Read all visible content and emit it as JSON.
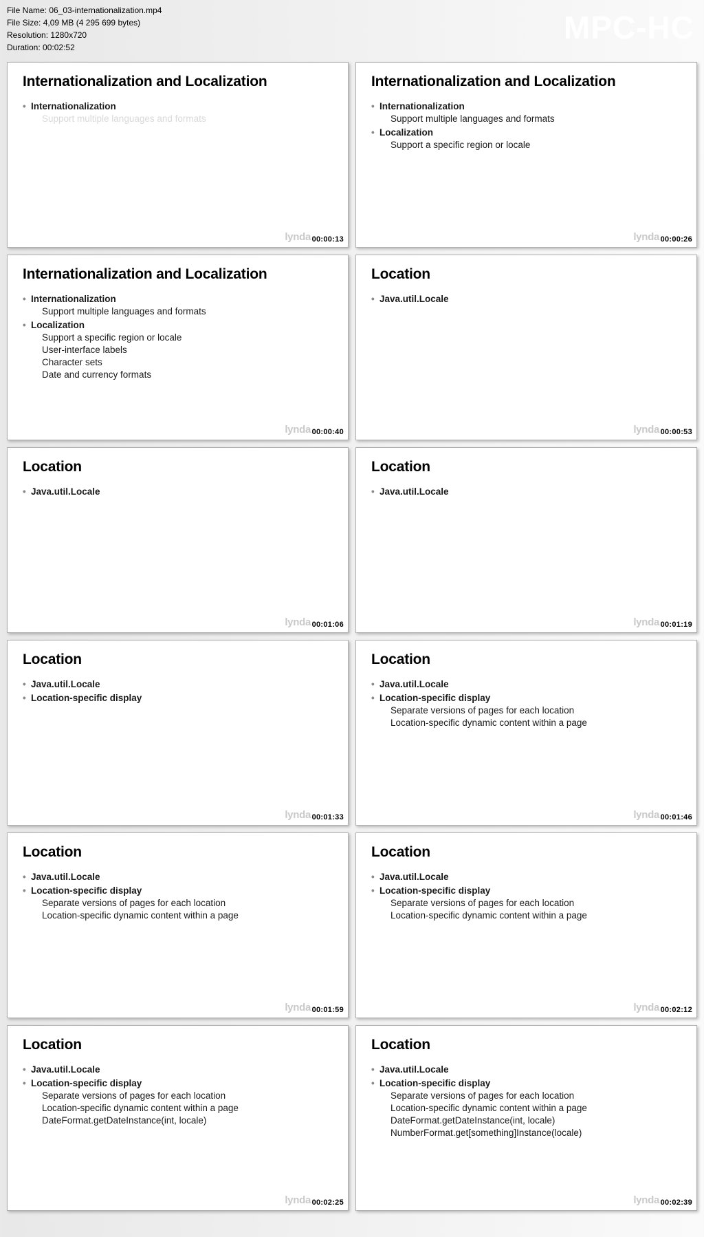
{
  "app_name": "MPC-HC",
  "file_info": {
    "name_label": "File Name:",
    "name_value": "06_03-internationalization.mp4",
    "size_label": "File Size:",
    "size_value": "4,09 MB (4 295 699 bytes)",
    "res_label": "Resolution:",
    "res_value": "1280x720",
    "dur_label": "Duration:",
    "dur_value": "00:02:52"
  },
  "watermark": "lynda",
  "thumbs": [
    {
      "ts": "00:00:13",
      "title": "Internationalization and Localization",
      "items": [
        {
          "text": "Internationalization",
          "bold": true
        },
        {
          "text": "Support multiple languages and formats",
          "sub": true,
          "faded": true
        }
      ]
    },
    {
      "ts": "00:00:26",
      "title": "Internationalization and Localization",
      "items": [
        {
          "text": "Internationalization",
          "bold": true
        },
        {
          "text": "Support multiple languages and formats",
          "sub": true
        },
        {
          "text": "Localization",
          "bold": true
        },
        {
          "text": "Support a specific region or locale",
          "sub": true
        }
      ]
    },
    {
      "ts": "00:00:40",
      "title": "Internationalization and Localization",
      "items": [
        {
          "text": "Internationalization",
          "bold": true
        },
        {
          "text": "Support multiple languages and formats",
          "sub": true
        },
        {
          "text": "Localization",
          "bold": true
        },
        {
          "text": "Support a specific region or locale",
          "sub": true
        },
        {
          "text": "User-interface labels",
          "sub": true
        },
        {
          "text": "Character sets",
          "sub": true
        },
        {
          "text": "Date and currency formats",
          "sub": true
        }
      ]
    },
    {
      "ts": "00:00:53",
      "title": "Location",
      "items": [
        {
          "text": "Java.util.Locale",
          "bold": true
        }
      ]
    },
    {
      "ts": "00:01:06",
      "title": "Location",
      "items": [
        {
          "text": "Java.util.Locale",
          "bold": true
        }
      ]
    },
    {
      "ts": "00:01:19",
      "title": "Location",
      "items": [
        {
          "text": "Java.util.Locale",
          "bold": true
        }
      ]
    },
    {
      "ts": "00:01:33",
      "title": "Location",
      "items": [
        {
          "text": "Java.util.Locale",
          "bold": true
        },
        {
          "text": "Location-specific display",
          "bold": true
        }
      ]
    },
    {
      "ts": "00:01:46",
      "title": "Location",
      "items": [
        {
          "text": "Java.util.Locale",
          "bold": true
        },
        {
          "text": "Location-specific display",
          "bold": true
        },
        {
          "text": "Separate versions of pages for each location",
          "sub": true
        },
        {
          "text": "Location-specific dynamic content within a page",
          "sub": true
        }
      ]
    },
    {
      "ts": "00:01:59",
      "title": "Location",
      "items": [
        {
          "text": "Java.util.Locale",
          "bold": true
        },
        {
          "text": "Location-specific display",
          "bold": true
        },
        {
          "text": "Separate versions of pages for each location",
          "sub": true
        },
        {
          "text": "Location-specific dynamic content within a page",
          "sub": true
        }
      ]
    },
    {
      "ts": "00:02:12",
      "title": "Location",
      "items": [
        {
          "text": "Java.util.Locale",
          "bold": true
        },
        {
          "text": "Location-specific display",
          "bold": true
        },
        {
          "text": "Separate versions of pages for each location",
          "sub": true
        },
        {
          "text": "Location-specific dynamic content within a page",
          "sub": true
        }
      ]
    },
    {
      "ts": "00:02:25",
      "title": "Location",
      "items": [
        {
          "text": "Java.util.Locale",
          "bold": true
        },
        {
          "text": "Location-specific display",
          "bold": true
        },
        {
          "text": "Separate versions of pages for each location",
          "sub": true
        },
        {
          "text": "Location-specific dynamic content within a page",
          "sub": true
        },
        {
          "text": "DateFormat.getDateInstance(int, locale)",
          "sub": true
        }
      ]
    },
    {
      "ts": "00:02:39",
      "title": "Location",
      "items": [
        {
          "text": "Java.util.Locale",
          "bold": true
        },
        {
          "text": "Location-specific display",
          "bold": true
        },
        {
          "text": "Separate versions of pages for each location",
          "sub": true
        },
        {
          "text": "Location-specific dynamic content within a page",
          "sub": true
        },
        {
          "text": "DateFormat.getDateInstance(int, locale)",
          "sub": true
        },
        {
          "text": "NumberFormat.get[something]Instance(locale)",
          "sub": true
        }
      ]
    }
  ]
}
